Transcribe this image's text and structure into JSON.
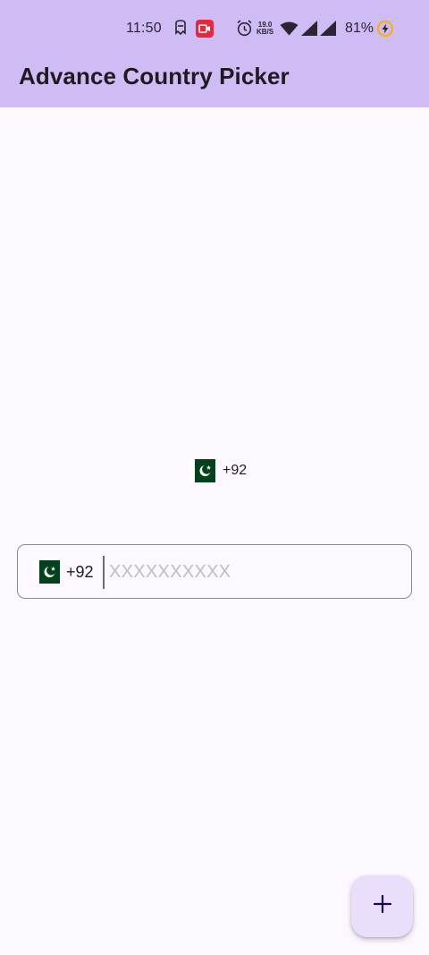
{
  "status_bar": {
    "time": "11:50",
    "network_speed_value": "19.0",
    "network_speed_unit": "KB/S",
    "battery_percent": "81%"
  },
  "app_bar": {
    "title": "Advance Country Picker"
  },
  "selected_country": {
    "flag_icon": "pakistan-flag-icon",
    "dial_code": "+92"
  },
  "phone_field": {
    "flag_icon": "pakistan-flag-icon",
    "dial_code": "+92",
    "value": "",
    "placeholder": "XXXXXXXXXX"
  },
  "fab": {
    "icon": "plus-icon"
  },
  "colors": {
    "app_bar": "#d0bcf5",
    "background": "#fdf7ff",
    "fab": "#e9dffb",
    "flag_green": "#01411c",
    "field_border": "#8e8a93"
  }
}
